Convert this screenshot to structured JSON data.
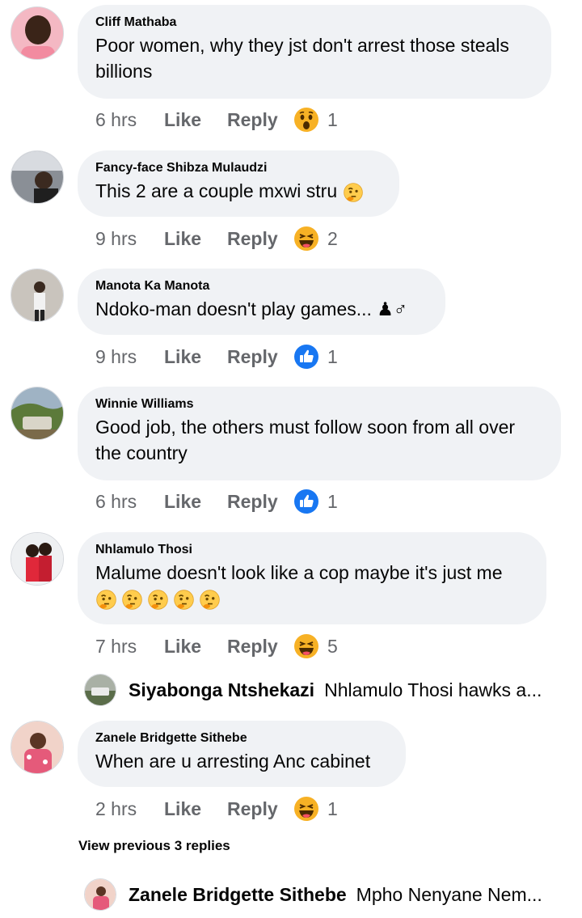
{
  "comments": [
    {
      "author": "Cliff Mathaba",
      "lines": [
        "Poor women, why they jst don't arrest those steals",
        "billions"
      ],
      "time": "6 hrs",
      "like": "Like",
      "reply": "Reply",
      "reaction": "wow-icon",
      "count": "1"
    },
    {
      "author": "Fancy-face Shibza Mulaudzi",
      "lines": [
        "This 2 are a couple mxwi stru"
      ],
      "inline_emoji": "thinking-face-icon",
      "time": "9 hrs",
      "like": "Like",
      "reply": "Reply",
      "reaction": "haha-icon",
      "count": "2"
    },
    {
      "author": "Manota Ka Manota",
      "lines": [
        "Ndoko-man doesn't play games... ♟♂"
      ],
      "time": "9 hrs",
      "like": "Like",
      "reply": "Reply",
      "reaction": "like-icon",
      "count": "1"
    },
    {
      "author": "Winnie Williams",
      "lines": [
        "Good job, the others must follow soon from all over",
        "the country"
      ],
      "time": "6 hrs",
      "like": "Like",
      "reply": "Reply",
      "reaction": "like-icon",
      "count": "1"
    },
    {
      "author": "Nhlamulo Thosi",
      "lines": [
        "Malume doesn't look like a cop maybe it's just me"
      ],
      "emoji_row": "thinking-face-icon x5",
      "time": "7 hrs",
      "like": "Like",
      "reply": "Reply",
      "reaction": "haha-icon",
      "count": "5"
    },
    {
      "author": "Zanele Bridgette Sithebe",
      "lines": [
        "When are u arresting Anc cabinet"
      ],
      "time": "2 hrs",
      "like": "Like",
      "reply": "Reply",
      "reaction": "haha-icon",
      "count": "1"
    }
  ],
  "replies": [
    {
      "author": "Siyabonga Ntshekazi",
      "text": "Nhlamulo Thosi hawks a..."
    },
    {
      "author": "Zanele Bridgette Sithebe",
      "text": "Mpho Nenyane Nem..."
    }
  ],
  "view_previous": "View previous 3 replies",
  "colors": {
    "bubble": "#f0f2f5",
    "meta": "#65676b",
    "like_blue": "#1877f2",
    "haha_yellow": "#f7b125"
  }
}
